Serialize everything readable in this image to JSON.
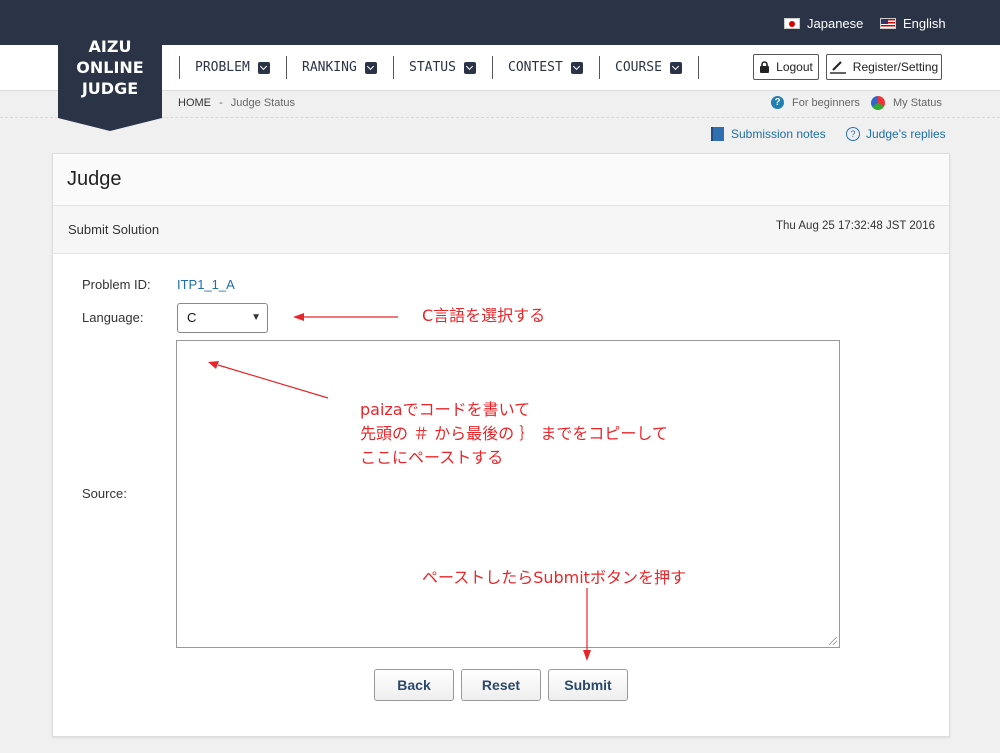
{
  "header": {
    "languages": [
      {
        "label": "Japanese",
        "icon": "japan-flag-icon"
      },
      {
        "label": "English",
        "icon": "us-flag-icon"
      }
    ],
    "logo_lines": [
      "AIZU",
      "ONLINE",
      "JUDGE"
    ],
    "nav": [
      {
        "label": "PROBLEM"
      },
      {
        "label": "RANKING"
      },
      {
        "label": "STATUS"
      },
      {
        "label": "CONTEST"
      },
      {
        "label": "COURSE"
      }
    ],
    "logout_label": "Logout",
    "register_label": "Register/Setting"
  },
  "breadcrumb": {
    "home": "HOME",
    "sep": "-",
    "current": "Judge Status"
  },
  "help_links": {
    "beginners": "For beginners",
    "my_status": "My Status"
  },
  "sub_links": {
    "notes": "Submission notes",
    "replies": "Judge's replies"
  },
  "panel": {
    "title": "Judge",
    "subtitle": "Submit Solution",
    "timestamp": "Thu Aug 25 17:32:48 JST 2016"
  },
  "form": {
    "problem_id_label": "Problem ID:",
    "problem_id_value": "ITP1_1_A",
    "language_label": "Language:",
    "language_value": "C",
    "source_label": "Source:",
    "source_value": "",
    "back_label": "Back",
    "reset_label": "Reset",
    "submit_label": "Submit"
  },
  "annotations": {
    "select_c": "C言語を選択する",
    "paste_code": "paizaでコードを書いて\n先頭の ＃ から最後の ｝ までをコピーして\nここにペーストする",
    "press_submit": "ペーストしたらSubmitボタンを押す",
    "color": "#e8262a"
  },
  "colors": {
    "header_bg": "#2b3447",
    "link": "#1f6fa8"
  }
}
